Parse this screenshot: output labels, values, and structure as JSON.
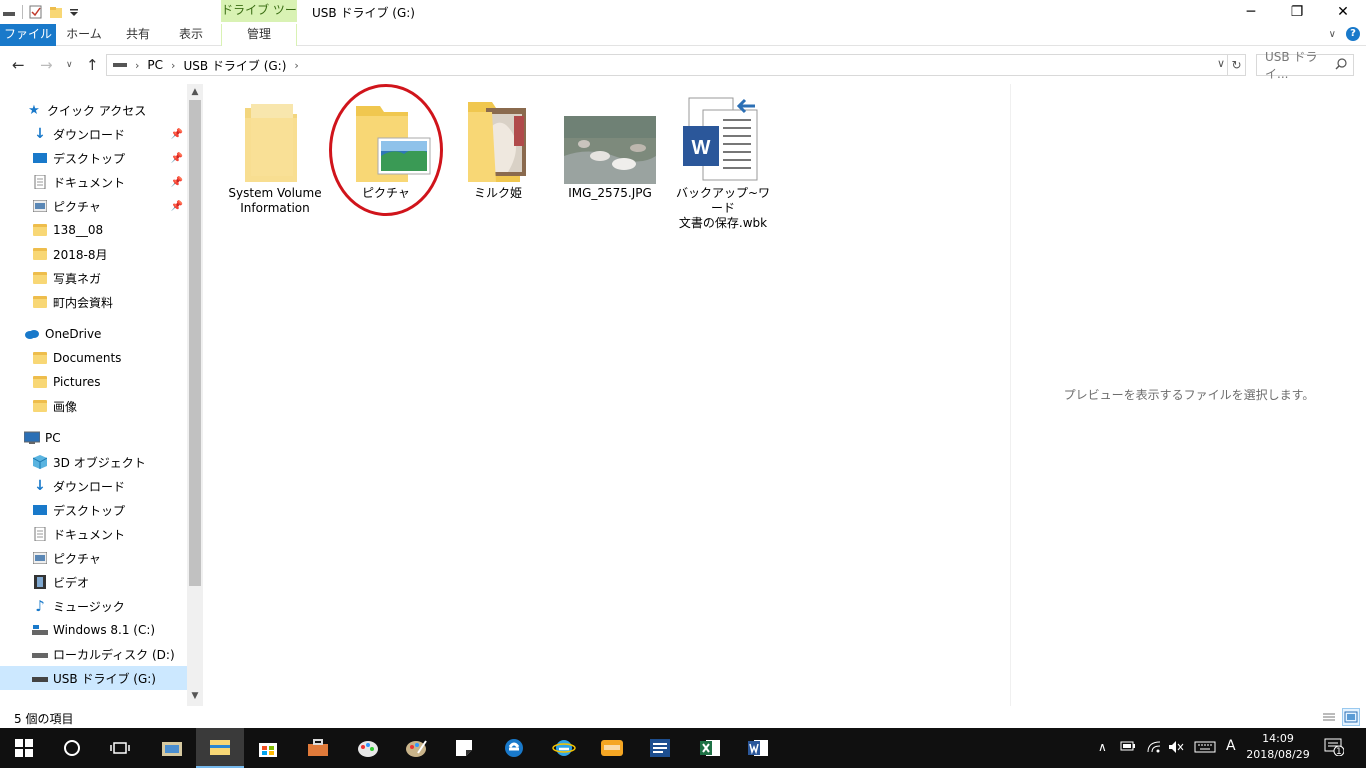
{
  "window": {
    "title": "USB ドライブ (G:)",
    "context_group": "ドライブ ツール",
    "minimize": "─",
    "restore": "❐",
    "close": "✕"
  },
  "ribbon": {
    "tabs": [
      "ファイル",
      "ホーム",
      "共有",
      "表示",
      "管理"
    ],
    "help": "?"
  },
  "address": {
    "crumbs": [
      "PC",
      "USB ドライブ (G:)"
    ],
    "search_placeholder": "USB ドライ..."
  },
  "nav": {
    "quick_access": "クイック アクセス",
    "quick_items": [
      "ダウンロード",
      "デスクトップ",
      "ドキュメント",
      "ピクチャ",
      "138__08",
      "2018-8月",
      "写真ネガ",
      "町内会資料"
    ],
    "onedrive": "OneDrive",
    "onedrive_items": [
      "Documents",
      "Pictures",
      "画像"
    ],
    "pc": "PC",
    "pc_items": [
      "3D オブジェクト",
      "ダウンロード",
      "デスクトップ",
      "ドキュメント",
      "ピクチャ",
      "ビデオ",
      "ミュージック",
      "Windows 8.1 (C:)",
      "ローカルディスク (D:)",
      "USB ドライブ (G:)"
    ]
  },
  "files": [
    {
      "name_line1": "System Volume",
      "name_line2": "Information",
      "type": "folder"
    },
    {
      "name_line1": "ピクチャ",
      "name_line2": "",
      "type": "pictures-folder"
    },
    {
      "name_line1": "ミルク姫",
      "name_line2": "",
      "type": "photo-folder"
    },
    {
      "name_line1": "IMG_2575.JPG",
      "name_line2": "",
      "type": "image"
    },
    {
      "name_line1": "バックアップ~ワード",
      "name_line2": "文書の保存.wbk",
      "type": "word-backup"
    }
  ],
  "preview": {
    "message": "プレビューを表示するファイルを選択します。"
  },
  "status": {
    "item_count": "5 個の項目"
  },
  "taskbar": {
    "time": "14:09",
    "date": "2018/08/29",
    "ime": "A",
    "notifications": "1"
  },
  "colors": {
    "accent": "#1979ca",
    "selection": "#cce8ff",
    "context_tab": "#d9f2b4",
    "highlight_circle": "#d0141b",
    "folder": "#f8d775",
    "taskbar": "#101010"
  }
}
